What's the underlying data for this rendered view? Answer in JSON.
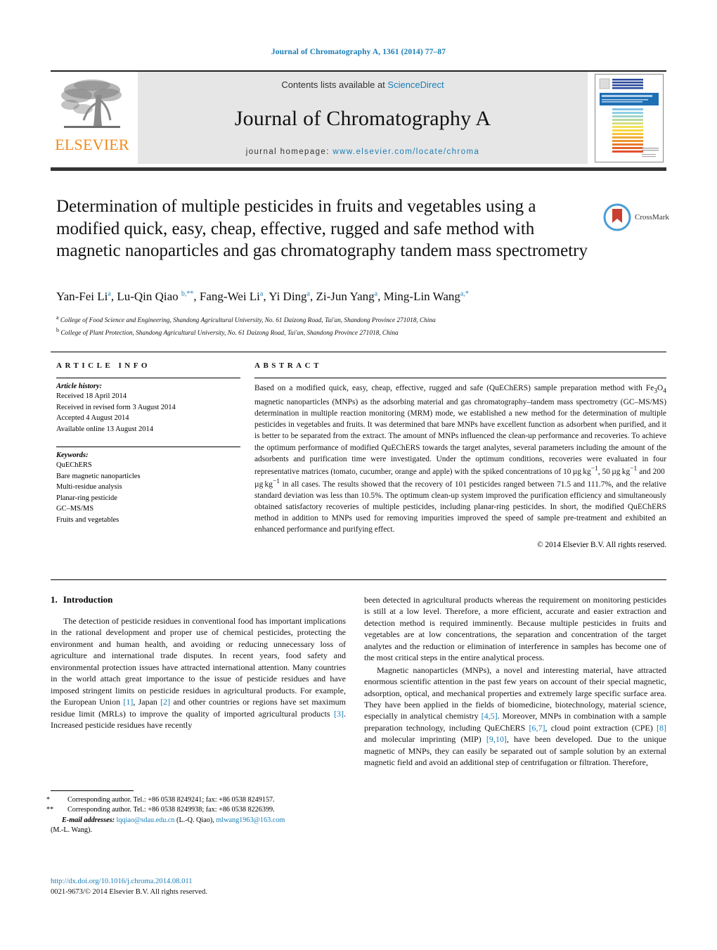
{
  "running_head": "Journal of Chromatography A, 1361 (2014) 77–87",
  "masthead": {
    "publisher": "ELSEVIER",
    "contents_prefix": "Contents lists available at ",
    "contents_link": "ScienceDirect",
    "journal_title": "Journal of Chromatography A",
    "homepage_prefix": "journal homepage:",
    "homepage_url": "www.elsevier.com/locate/chroma",
    "cover_title": "JOURNAL OF CHROMATOGRAPHY A",
    "cover_subtitle": "INCLUDING ELECTROPHORESIS AND OTHER SEPARATION METHODS"
  },
  "article": {
    "title": "Determination of multiple pesticides in fruits and vegetables using a modified quick, easy, cheap, effective, rugged and safe method with magnetic nanoparticles and gas chromatography tandem mass spectrometry",
    "crossmark_label": "CrossMark",
    "authors_html": "Yan-Fei Li<sup>a</sup>, Lu-Qin Qiao <sup>b,**</sup>, Fang-Wei Li<sup>a</sup>, Yi Ding<sup>a</sup>, Zi-Jun Yang<sup>a</sup>, Ming-Lin Wang<sup>a,</sup><sup>*</sup>",
    "affiliations": [
      "College of Food Science and Engineering, Shandong Agricultural University, No. 61 Daizong Road, Tai'an, Shandong Province 271018, China",
      "College of Plant Protection, Shandong Agricultural University, No. 61 Daizong Road, Tai'an, Shandong Province 271018, China"
    ],
    "affiliation_marks": [
      "a",
      "b"
    ]
  },
  "article_info": {
    "heading": "ARTICLE INFO",
    "history_label": "Article history:",
    "history": [
      "Received 18 April 2014",
      "Received in revised form 3 August 2014",
      "Accepted 4 August 2014",
      "Available online 13 August 2014"
    ],
    "keywords_label": "Keywords:",
    "keywords": [
      "QuEChERS",
      "Bare magnetic nanoparticles",
      "Multi-residue analysis",
      "Planar-ring pesticide",
      "GC–MS/MS",
      "Fruits and vegetables"
    ]
  },
  "abstract": {
    "heading": "ABSTRACT",
    "body_html": "Based on a modified quick, easy, cheap, effective, rugged and safe (QuEChERS) sample preparation method with Fe<sub>3</sub>O<sub>4</sub> magnetic nanoparticles (MNPs) as the adsorbing material and gas chromatography–tandem mass spectrometry (GC–MS/MS) determination in multiple reaction monitoring (MRM) mode, we established a new method for the determination of multiple pesticides in vegetables and fruits. It was determined that bare MNPs have excellent function as adsorbent when purified, and it is better to be separated from the extract. The amount of MNPs influenced the clean-up performance and recoveries. To achieve the optimum performance of modified QuEChERS towards the target analytes, several parameters including the amount of the adsorbents and purification time were investigated. Under the optimum conditions, recoveries were evaluated in four representative matrices (tomato, cucumber, orange and apple) with the spiked concentrations of 10&#8201;&#181;g&#8201;kg<sup>&#8722;1</sup>, 50&#8201;&#181;g&#8201;kg<sup>&#8722;1</sup> and 200&#8201;&#181;g&#8201;kg<sup>&#8722;1</sup> in all cases. The results showed that the recovery of 101 pesticides ranged between 71.5 and 111.7%, and the relative standard deviation was less than 10.5%. The optimum clean-up system improved the purification efficiency and simultaneously obtained satisfactory recoveries of multiple pesticides, including planar-ring pesticides. In short, the modified QuEChERS method in addition to MNPs used for removing impurities improved the speed of sample pre-treatment and exhibited an enhanced performance and purifying effect.",
    "copyright": "© 2014 Elsevier B.V. All rights reserved."
  },
  "introduction": {
    "number": "1.",
    "title": "Introduction",
    "left_paragraphs_html": [
      "The detection of pesticide residues in conventional food has important implications in the rational development and proper use of chemical pesticides, protecting the environment and human health, and avoiding or reducing unnecessary loss of agriculture and international trade disputes. In recent years, food safety and environmental protection issues have attracted international attention. Many countries in the world attach great importance to the issue of pesticide residues and have imposed stringent limits on pesticide residues in agricultural products. For example, the European Union <span class=\"link\">[1]</span>, Japan <span class=\"link\">[2]</span> and other countries or regions have set maximum residue limit (MRLs) to improve the quality of imported agricultural products <span class=\"link\">[3]</span>. Increased pesticide residues have recently"
    ],
    "right_paragraphs_html": [
      "been detected in agricultural products whereas the requirement on monitoring pesticides is still at a low level. Therefore, a more efficient, accurate and easier extraction and detection method is required imminently. Because multiple pesticides in fruits and vegetables are at low concentrations, the separation and concentration of the target analytes and the reduction or elimination of interference in samples has become one of the most critical steps in the entire analytical process.",
      "Magnetic nanoparticles (MNPs), a novel and interesting material, have attracted enormous scientific attention in the past few years on account of their special magnetic, adsorption, optical, and mechanical properties and extremely large specific surface area. They have been applied in the fields of biomedicine, biotechnology, material science, especially in analytical chemistry <span class=\"link\">[4,5]</span>. Moreover, MNPs in combination with a sample preparation technology, including QuEChERS <span class=\"link\">[6,7]</span>, cloud point extraction (CPE) <span class=\"link\">[8]</span> and molecular imprinting (MIP) <span class=\"link\">[9,10]</span>, have been developed. Due to the unique magnetic of MNPs, they can easily be separated out of sample solution by an external magnetic field and avoid an additional step of centrifugation or filtration. Therefore,"
    ]
  },
  "footnotes": {
    "corresponding_1_mark": "*",
    "corresponding_1": "Corresponding author. Tel.: +86 0538 8249241; fax: +86 0538 8249157.",
    "corresponding_2_mark": "**",
    "corresponding_2": "Corresponding author. Tel.: +86 0538 8249938; fax: +86 0538 8226399.",
    "email_label": "E-mail addresses:",
    "email_1": "lqqiao@sdau.edu.cn",
    "email_1_owner": "(L.-Q. Qiao),",
    "email_2": "mlwang1963@163.com",
    "email_2_owner": "(M.-L. Wang)."
  },
  "doi": {
    "url": "http://dx.doi.org/10.1016/j.chroma.2014.08.011",
    "issn_line": "0021-9673/© 2014 Elsevier B.V. All rights reserved."
  },
  "colors": {
    "link": "#1a7db6",
    "elsevier_orange": "#f08a1b",
    "masthead_grey": "#e6e6e6",
    "cover_blue": "#1f6fb5"
  }
}
